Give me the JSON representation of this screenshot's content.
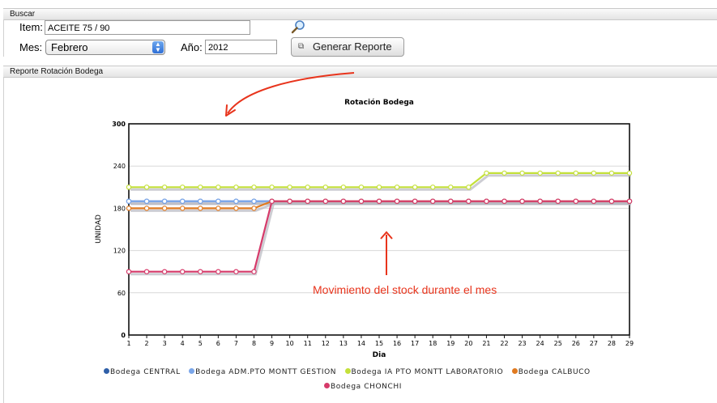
{
  "search_panel": {
    "title": "Buscar",
    "item_label": "Item:",
    "item_value": "ACEITE   75 / 90",
    "mes_label": "Mes:",
    "mes_value": "Febrero",
    "anio_label": "Año:",
    "anio_value": "2012",
    "generate_button": "Generar Reporte"
  },
  "report_panel": {
    "title": "Reporte Rotación Bodega"
  },
  "annotation": {
    "text": "Movimiento del stock durante el mes",
    "color": "#e8341c"
  },
  "chart_data": {
    "type": "line",
    "title": "Rotación Bodega",
    "xlabel": "Dia",
    "ylabel": "UNIDAD",
    "ylim": [
      0,
      300
    ],
    "yticks": [
      0,
      60,
      120,
      180,
      240,
      300
    ],
    "x": [
      1,
      2,
      3,
      4,
      5,
      6,
      7,
      8,
      9,
      10,
      11,
      12,
      13,
      14,
      15,
      16,
      17,
      18,
      19,
      20,
      21,
      22,
      23,
      24,
      25,
      26,
      27,
      28,
      29
    ],
    "grid": true,
    "legend_position": "bottom",
    "series": [
      {
        "name": "Bodega CENTRAL",
        "color": "#2f5fa8",
        "values": [
          190,
          190,
          190,
          190,
          190,
          190,
          190,
          190,
          190,
          190,
          190,
          190,
          190,
          190,
          190,
          190,
          190,
          190,
          190,
          190,
          190,
          190,
          190,
          190,
          190,
          190,
          190,
          190,
          190
        ]
      },
      {
        "name": "Bodega ADM.PTO MONTT GESTION",
        "color": "#7aa6ea",
        "values": [
          190,
          190,
          190,
          190,
          190,
          190,
          190,
          190,
          190,
          190,
          190,
          190,
          190,
          190,
          190,
          190,
          190,
          190,
          190,
          190,
          190,
          190,
          190,
          190,
          190,
          190,
          190,
          190,
          190
        ]
      },
      {
        "name": "Bodega IA PTO MONTT LABORATORIO",
        "color": "#c4e03a",
        "values": [
          210,
          210,
          210,
          210,
          210,
          210,
          210,
          210,
          210,
          210,
          210,
          210,
          210,
          210,
          210,
          210,
          210,
          210,
          210,
          210,
          230,
          230,
          230,
          230,
          230,
          230,
          230,
          230,
          230
        ]
      },
      {
        "name": "Bodega CALBUCO",
        "color": "#e07a20",
        "values": [
          180,
          180,
          180,
          180,
          180,
          180,
          180,
          180,
          190,
          190,
          190,
          190,
          190,
          190,
          190,
          190,
          190,
          190,
          190,
          190,
          190,
          190,
          190,
          190,
          190,
          190,
          190,
          190,
          190
        ]
      },
      {
        "name": "Bodega CHONCHI",
        "color": "#d63a6a",
        "values": [
          90,
          90,
          90,
          90,
          90,
          90,
          90,
          90,
          190,
          190,
          190,
          190,
          190,
          190,
          190,
          190,
          190,
          190,
          190,
          190,
          190,
          190,
          190,
          190,
          190,
          190,
          190,
          190,
          190
        ]
      }
    ]
  }
}
